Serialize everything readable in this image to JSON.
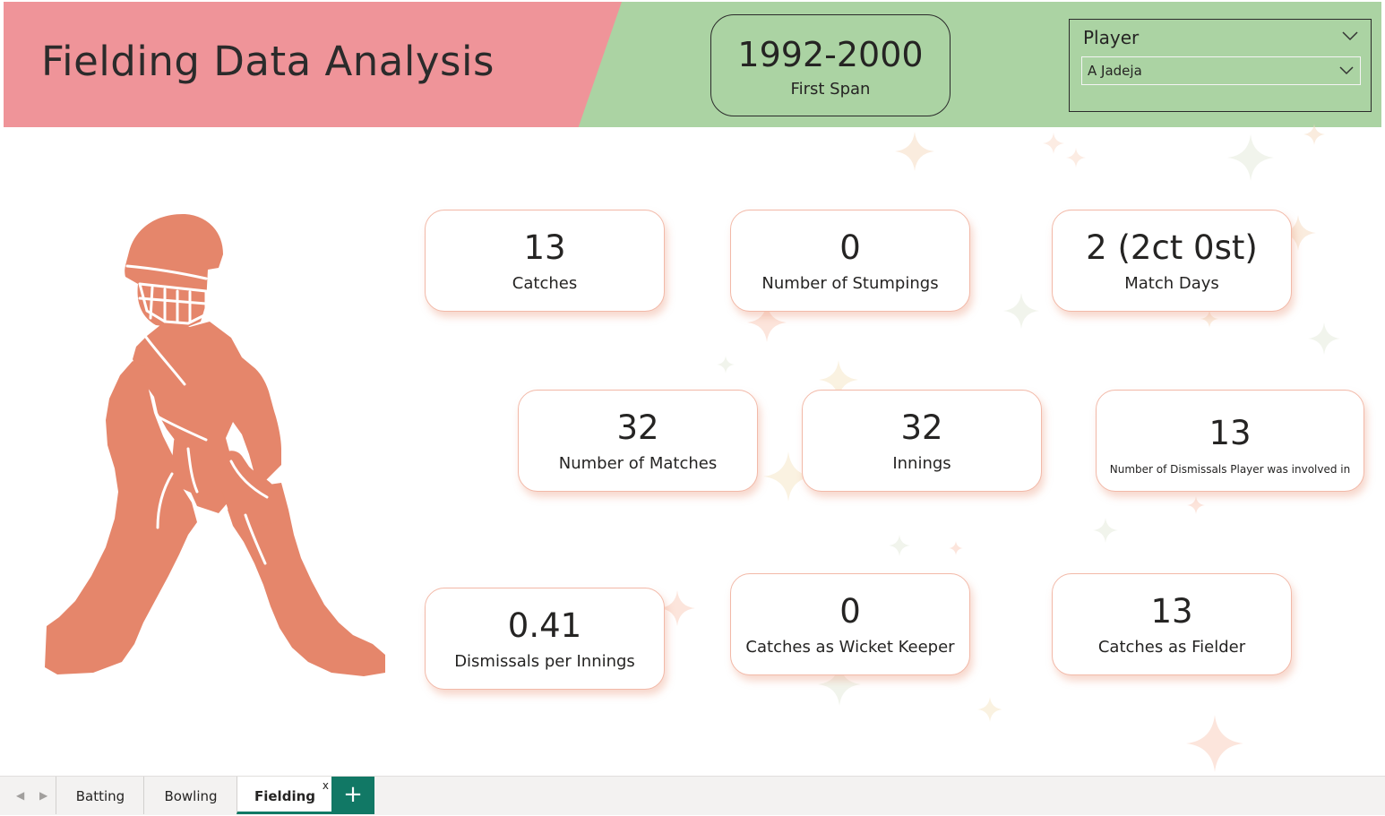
{
  "header": {
    "title": "Fielding Data Analysis",
    "span_value": "1992-2000",
    "span_label": "First Span"
  },
  "slicer": {
    "title": "Player",
    "selected": "A Jadeja"
  },
  "kpis": {
    "catches": {
      "value": "13",
      "label": "Catches"
    },
    "stumpings": {
      "value": "0",
      "label": "Number of Stumpings"
    },
    "match_days": {
      "value": "2 (2ct 0st)",
      "label": "Match Days"
    },
    "matches": {
      "value": "32",
      "label": "Number of Matches"
    },
    "innings": {
      "value": "32",
      "label": "Innings"
    },
    "dismissals": {
      "value": "13",
      "label": "Number of Dismissals Player was involved in"
    },
    "dismissals_per_innings": {
      "value": "0.41",
      "label": "Dismissals per Innings"
    },
    "catches_wk": {
      "value": "0",
      "label": "Catches as Wicket Keeper"
    },
    "catches_fielder": {
      "value": "13",
      "label": "Catches as Fielder"
    }
  },
  "tabs": {
    "items": [
      {
        "label": "Batting"
      },
      {
        "label": "Bowling"
      },
      {
        "label": "Fielding",
        "active": true
      }
    ],
    "close_glyph": "x",
    "add_glyph": "+",
    "prev_glyph": "◀",
    "next_glyph": "▶"
  },
  "colors": {
    "header_pink": "#ef9499",
    "header_green": "#abd3a3",
    "accent_orange": "#e5866b",
    "tab_accent": "#117865"
  }
}
